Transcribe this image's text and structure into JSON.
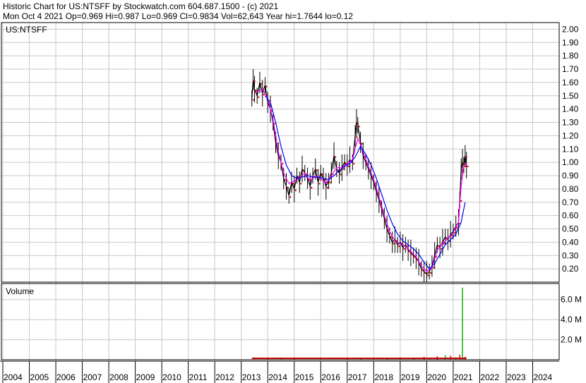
{
  "header": {
    "line1": "Historic Chart for US:NTSFF by Stockwatch.com 604.687.1500 - (c) 2021",
    "line2": "Mon Oct  4 2021  Op=0.969  Hi=0.987  Lo=0.969  Cl=0.9834  Vol=62,643  Year hi=1.7644  lo=0.12"
  },
  "chart_data": {
    "type": "line",
    "symbol": "US:NTSFF",
    "volume_label": "Volume",
    "price_ylim": [
      0.1,
      2.05
    ],
    "price_ticks": [
      "2.00",
      "1.90",
      "1.80",
      "1.70",
      "1.60",
      "1.50",
      "1.40",
      "1.30",
      "1.20",
      "1.10",
      "1.00",
      "0.90",
      "0.80",
      "0.70",
      "0.60",
      "0.50",
      "0.40",
      "0.30",
      "0.20"
    ],
    "volume_ylim": [
      0,
      7.6
    ],
    "volume_ticks": [
      "6.0 M",
      "4.0 M",
      "2.0 M"
    ],
    "x_years": [
      "2004",
      "2005",
      "2006",
      "2007",
      "2008",
      "2009",
      "2010",
      "2011",
      "2012",
      "2013",
      "2014",
      "2015",
      "2016",
      "2017",
      "2018",
      "2019",
      "2020",
      "2021",
      "2022",
      "2023",
      "2024"
    ],
    "grid": true,
    "colors": {
      "price": "#000000",
      "ma_short": "#ff00ff",
      "ma_long": "#0000ff",
      "close_dots": "#cc0000",
      "volume": "#00aa00",
      "volume_down": "#cc0000"
    },
    "price_series": [
      [
        2013.4,
        1.48
      ],
      [
        2013.45,
        1.62
      ],
      [
        2013.5,
        1.55
      ],
      [
        2013.6,
        1.5
      ],
      [
        2013.7,
        1.6
      ],
      [
        2013.8,
        1.52
      ],
      [
        2013.9,
        1.58
      ],
      [
        2014.0,
        1.45
      ],
      [
        2014.1,
        1.4
      ],
      [
        2014.2,
        1.3
      ],
      [
        2014.3,
        1.15
      ],
      [
        2014.4,
        1.05
      ],
      [
        2014.5,
        1.0
      ],
      [
        2014.6,
        0.88
      ],
      [
        2014.7,
        0.82
      ],
      [
        2014.8,
        0.75
      ],
      [
        2014.9,
        0.85
      ],
      [
        2015.0,
        0.8
      ],
      [
        2015.1,
        0.9
      ],
      [
        2015.2,
        0.85
      ],
      [
        2015.3,
        0.95
      ],
      [
        2015.4,
        0.92
      ],
      [
        2015.5,
        0.88
      ],
      [
        2015.6,
        0.82
      ],
      [
        2015.7,
        0.9
      ],
      [
        2015.8,
        0.95
      ],
      [
        2015.9,
        0.85
      ],
      [
        2016.0,
        0.92
      ],
      [
        2016.1,
        0.88
      ],
      [
        2016.2,
        0.82
      ],
      [
        2016.3,
        0.86
      ],
      [
        2016.4,
        0.92
      ],
      [
        2016.5,
        1.05
      ],
      [
        2016.6,
        0.95
      ],
      [
        2016.7,
        0.92
      ],
      [
        2016.8,
        0.96
      ],
      [
        2016.9,
        1.0
      ],
      [
        2017.0,
        0.98
      ],
      [
        2017.1,
        1.02
      ],
      [
        2017.2,
        1.0
      ],
      [
        2017.3,
        1.2
      ],
      [
        2017.35,
        1.3
      ],
      [
        2017.4,
        1.28
      ],
      [
        2017.5,
        1.15
      ],
      [
        2017.6,
        1.05
      ],
      [
        2017.7,
        1.0
      ],
      [
        2017.8,
        0.95
      ],
      [
        2017.9,
        0.9
      ],
      [
        2018.0,
        0.85
      ],
      [
        2018.1,
        0.78
      ],
      [
        2018.2,
        0.72
      ],
      [
        2018.3,
        0.65
      ],
      [
        2018.4,
        0.58
      ],
      [
        2018.5,
        0.5
      ],
      [
        2018.6,
        0.45
      ],
      [
        2018.7,
        0.4
      ],
      [
        2018.8,
        0.42
      ],
      [
        2018.9,
        0.38
      ],
      [
        2019.0,
        0.4
      ],
      [
        2019.1,
        0.36
      ],
      [
        2019.2,
        0.38
      ],
      [
        2019.3,
        0.34
      ],
      [
        2019.4,
        0.32
      ],
      [
        2019.5,
        0.3
      ],
      [
        2019.6,
        0.28
      ],
      [
        2019.7,
        0.25
      ],
      [
        2019.8,
        0.2
      ],
      [
        2019.9,
        0.18
      ],
      [
        2020.0,
        0.16
      ],
      [
        2020.1,
        0.18
      ],
      [
        2020.2,
        0.22
      ],
      [
        2020.3,
        0.3
      ],
      [
        2020.4,
        0.38
      ],
      [
        2020.5,
        0.36
      ],
      [
        2020.6,
        0.4
      ],
      [
        2020.7,
        0.44
      ],
      [
        2020.8,
        0.42
      ],
      [
        2020.9,
        0.46
      ],
      [
        2021.0,
        0.48
      ],
      [
        2021.1,
        0.52
      ],
      [
        2021.2,
        0.55
      ],
      [
        2021.25,
        0.72
      ],
      [
        2021.3,
        0.95
      ],
      [
        2021.35,
        1.0
      ],
      [
        2021.4,
        0.98
      ],
      [
        2021.45,
        1.05
      ],
      [
        2021.5,
        0.98
      ]
    ],
    "ma_short": [
      [
        2013.5,
        1.52
      ],
      [
        2013.8,
        1.55
      ],
      [
        2014.0,
        1.48
      ],
      [
        2014.2,
        1.32
      ],
      [
        2014.4,
        1.08
      ],
      [
        2014.6,
        0.92
      ],
      [
        2014.8,
        0.84
      ],
      [
        2015.0,
        0.86
      ],
      [
        2015.2,
        0.88
      ],
      [
        2015.4,
        0.92
      ],
      [
        2015.6,
        0.86
      ],
      [
        2015.8,
        0.9
      ],
      [
        2016.0,
        0.88
      ],
      [
        2016.2,
        0.84
      ],
      [
        2016.4,
        0.9
      ],
      [
        2016.6,
        0.96
      ],
      [
        2016.8,
        0.96
      ],
      [
        2017.0,
        0.99
      ],
      [
        2017.2,
        1.02
      ],
      [
        2017.4,
        1.18
      ],
      [
        2017.6,
        1.08
      ],
      [
        2017.8,
        0.97
      ],
      [
        2018.0,
        0.87
      ],
      [
        2018.2,
        0.74
      ],
      [
        2018.4,
        0.6
      ],
      [
        2018.6,
        0.48
      ],
      [
        2018.8,
        0.41
      ],
      [
        2019.0,
        0.39
      ],
      [
        2019.2,
        0.37
      ],
      [
        2019.4,
        0.33
      ],
      [
        2019.6,
        0.29
      ],
      [
        2019.8,
        0.22
      ],
      [
        2020.0,
        0.18
      ],
      [
        2020.2,
        0.21
      ],
      [
        2020.4,
        0.34
      ],
      [
        2020.6,
        0.39
      ],
      [
        2020.8,
        0.43
      ],
      [
        2021.0,
        0.47
      ],
      [
        2021.2,
        0.55
      ],
      [
        2021.3,
        0.82
      ],
      [
        2021.4,
        0.97
      ],
      [
        2021.5,
        0.99
      ]
    ],
    "ma_long": [
      [
        2013.9,
        1.5
      ],
      [
        2014.1,
        1.45
      ],
      [
        2014.3,
        1.3
      ],
      [
        2014.5,
        1.12
      ],
      [
        2014.7,
        0.98
      ],
      [
        2014.9,
        0.9
      ],
      [
        2015.1,
        0.88
      ],
      [
        2015.3,
        0.89
      ],
      [
        2015.5,
        0.9
      ],
      [
        2015.7,
        0.89
      ],
      [
        2015.9,
        0.89
      ],
      [
        2016.1,
        0.88
      ],
      [
        2016.3,
        0.87
      ],
      [
        2016.5,
        0.9
      ],
      [
        2016.7,
        0.94
      ],
      [
        2016.9,
        0.97
      ],
      [
        2017.1,
        0.99
      ],
      [
        2017.3,
        1.04
      ],
      [
        2017.5,
        1.12
      ],
      [
        2017.7,
        1.06
      ],
      [
        2017.9,
        0.98
      ],
      [
        2018.1,
        0.88
      ],
      [
        2018.3,
        0.76
      ],
      [
        2018.5,
        0.64
      ],
      [
        2018.7,
        0.54
      ],
      [
        2018.9,
        0.46
      ],
      [
        2019.1,
        0.41
      ],
      [
        2019.3,
        0.38
      ],
      [
        2019.5,
        0.35
      ],
      [
        2019.7,
        0.31
      ],
      [
        2019.9,
        0.25
      ],
      [
        2020.1,
        0.2
      ],
      [
        2020.3,
        0.24
      ],
      [
        2020.5,
        0.31
      ],
      [
        2020.7,
        0.38
      ],
      [
        2020.9,
        0.42
      ],
      [
        2021.1,
        0.46
      ],
      [
        2021.3,
        0.55
      ],
      [
        2021.45,
        0.7
      ]
    ],
    "volume_series": [
      [
        2013.5,
        0.05
      ],
      [
        2014.0,
        0.08
      ],
      [
        2014.5,
        0.06
      ],
      [
        2015.0,
        0.07
      ],
      [
        2015.5,
        0.05
      ],
      [
        2016.0,
        0.06
      ],
      [
        2016.5,
        0.05
      ],
      [
        2017.0,
        0.07
      ],
      [
        2017.5,
        0.09
      ],
      [
        2018.0,
        0.06
      ],
      [
        2018.5,
        0.08
      ],
      [
        2019.0,
        0.1
      ],
      [
        2019.5,
        0.12
      ],
      [
        2019.9,
        0.3
      ],
      [
        2020.1,
        0.2
      ],
      [
        2020.4,
        0.35
      ],
      [
        2020.7,
        0.45
      ],
      [
        2020.9,
        0.4
      ],
      [
        2021.1,
        0.25
      ],
      [
        2021.25,
        0.5
      ],
      [
        2021.35,
        7.2
      ],
      [
        2021.45,
        0.3
      ]
    ]
  }
}
